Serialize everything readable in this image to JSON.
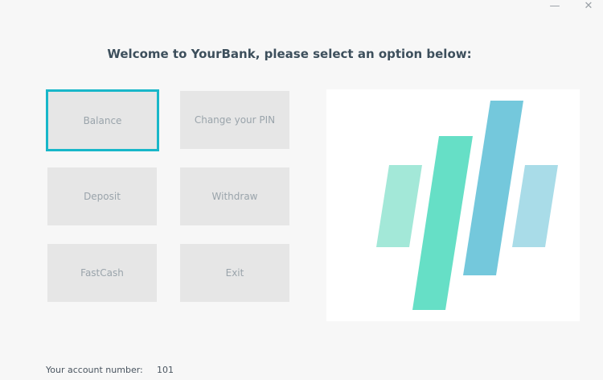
{
  "window": {
    "minimize_label": "—",
    "close_label": "✕"
  },
  "header": {
    "title": "Welcome to YourBank, please select an option below:"
  },
  "menu": {
    "balance": "Balance",
    "change_pin": "Change your PIN",
    "deposit": "Deposit",
    "withdraw": "Withdraw",
    "fastcash": "FastCash",
    "exit": "Exit"
  },
  "logo": {
    "colors": {
      "light_green": "#a3e8d8",
      "green": "#66dfc6",
      "blue": "#74c8dc",
      "light_blue": "#a9dce8"
    }
  },
  "footer": {
    "account_label": "Your account number:",
    "account_number": "101"
  },
  "colors": {
    "background": "#f7f7f7",
    "tile": "#e6e6e6",
    "focus_border": "#18b7c9",
    "title_text": "#3d4f5c"
  }
}
